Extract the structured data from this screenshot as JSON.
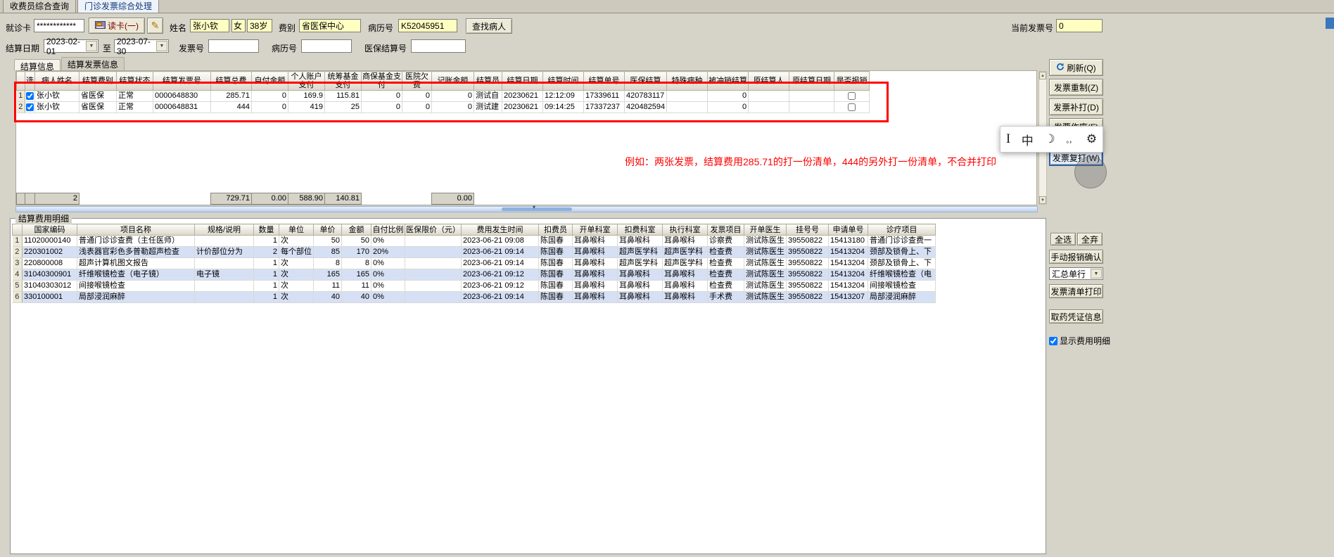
{
  "window_tabs": [
    {
      "label": "收费员综合查询",
      "active": false
    },
    {
      "label": "门诊发票综合处理",
      "active": true
    }
  ],
  "toolbar": {
    "visit_card_label": "就诊卡",
    "visit_card_value": "************",
    "read_card_button": "读卡(一)",
    "name_label": "姓名",
    "name_value": "张小钦",
    "gender_value": "女",
    "age_value": "38岁",
    "fee_type_label": "费别",
    "fee_type_value": "省医保中心",
    "mrn_label": "病历号",
    "mrn_value": "K52045951",
    "find_patient_button": "查找病人",
    "current_invoice_label": "当前发票号",
    "current_invoice_value": "0"
  },
  "filter": {
    "date_label": "结算日期",
    "date_from": "2023-02-01",
    "to_label": "至",
    "date_to": "2023-07-30",
    "invoice_no_label": "发票号",
    "invoice_no_value": "",
    "mrn_label": "病历号",
    "mrn_value": "",
    "insurance_no_label": "医保结算号",
    "insurance_no_value": ""
  },
  "page_tabs": [
    {
      "label": "结算信息",
      "active": true
    },
    {
      "label": "结算发票信息",
      "active": false
    }
  ],
  "settlement": {
    "columns": [
      "选",
      "病人姓名",
      "结算费别",
      "结算状态",
      "结算发票号",
      "结算总费",
      "自付金额",
      "个人账户支付",
      "统筹基金支付",
      "商保基金支付",
      "医院欠费",
      "记账金额",
      "结算员",
      "结算日期",
      "结算时间",
      "结算单号",
      "医保结算",
      "特殊病种",
      "被冲销结算",
      "原结算人",
      "原结算日期",
      "是否报销"
    ],
    "rows": [
      {
        "selected": true,
        "reimbursed": false,
        "cells": [
          "张小钦",
          "省医保",
          "正常",
          "0000648830",
          "285.71",
          "0",
          "169.9",
          "115.81",
          "0",
          "0",
          "0",
          "测试自",
          "20230621",
          "12:12:09",
          "17339611",
          "420783117",
          "",
          "0",
          "",
          ""
        ]
      },
      {
        "selected": true,
        "reimbursed": false,
        "cells": [
          "张小钦",
          "省医保",
          "正常",
          "0000648831",
          "444",
          "0",
          "419",
          "25",
          "0",
          "0",
          "0",
          "测试建",
          "20230621",
          "09:14:25",
          "17337237",
          "420482594",
          "",
          "0",
          "",
          ""
        ]
      }
    ],
    "summary": {
      "count": "2",
      "total_fee": "729.71",
      "self_pay": "0.00",
      "personal_account": "588.90",
      "pooled_fund": "140.81",
      "book_amount": "0.00"
    }
  },
  "annotation": "例如：两张发票，结算费用285.71的打一份清单，444的另外打一份清单，不合并打印",
  "detail": {
    "group_title": "结算费用明细",
    "columns": [
      "国家编码",
      "项目名称",
      "规格/说明",
      "数量",
      "单位",
      "单价",
      "金额",
      "自付比例",
      "医保限价（元）",
      "费用发生时间",
      "扣费员",
      "开单科室",
      "扣费科室",
      "执行科室",
      "发票项目",
      "开单医生",
      "挂号号",
      "申请单号",
      "诊疗项目"
    ],
    "rows": [
      [
        "11020000140",
        "普通门诊诊查费（主任医师）",
        "",
        "1",
        "次",
        "50",
        "50",
        "0%",
        "",
        "2023-06-21 09:08",
        "陈国春",
        "耳鼻喉科",
        "耳鼻喉科",
        "耳鼻喉科",
        "诊察费",
        "测试陈医生",
        "39550822",
        "15413180",
        "普通门诊诊查费一"
      ],
      [
        "220301002",
        "浅表器官彩色多普勒超声检查",
        "计价部位分为",
        "2",
        "每个部位",
        "85",
        "170",
        "20%",
        "",
        "2023-06-21 09:14",
        "陈国春",
        "耳鼻喉科",
        "超声医学科",
        "超声医学科",
        "检查费",
        "测试陈医生",
        "39550822",
        "15413204",
        "颈部及锁骨上、下"
      ],
      [
        "220800008",
        "超声计算机图文报告",
        "",
        "1",
        "次",
        "8",
        "8",
        "0%",
        "",
        "2023-06-21 09:14",
        "陈国春",
        "耳鼻喉科",
        "超声医学科",
        "超声医学科",
        "检查费",
        "测试陈医生",
        "39550822",
        "15413204",
        "颈部及锁骨上、下"
      ],
      [
        "31040300901",
        "纤维喉镜检查（电子镜）",
        "电子镜",
        "1",
        "次",
        "165",
        "165",
        "0%",
        "",
        "2023-06-21 09:12",
        "陈国春",
        "耳鼻喉科",
        "耳鼻喉科",
        "耳鼻喉科",
        "检查费",
        "测试陈医生",
        "39550822",
        "15413204",
        "纤维喉镜检查（电"
      ],
      [
        "31040303012",
        "间接喉镜检查",
        "",
        "1",
        "次",
        "11",
        "11",
        "0%",
        "",
        "2023-06-21 09:12",
        "陈国春",
        "耳鼻喉科",
        "耳鼻喉科",
        "耳鼻喉科",
        "检查费",
        "测试陈医生",
        "39550822",
        "15413204",
        "间接喉镜检查"
      ],
      [
        "330100001",
        "局部浸润麻醉",
        "",
        "1",
        "次",
        "40",
        "40",
        "0%",
        "",
        "2023-06-21 09:14",
        "陈国春",
        "耳鼻喉科",
        "耳鼻喉科",
        "耳鼻喉科",
        "手术费",
        "测试陈医生",
        "39550822",
        "15413207",
        "局部浸润麻醉"
      ]
    ]
  },
  "right_panel": {
    "buttons": [
      {
        "name": "refresh-button",
        "label": "刷新(Q)",
        "icon": "refresh"
      },
      {
        "name": "invoice-remake-button",
        "label": "发票重制(Z)"
      },
      {
        "name": "invoice-supplement-print-button",
        "label": "发票补打(D)"
      },
      {
        "name": "invoice-void-button",
        "label": "发票作废(F)"
      },
      {
        "name": "invoice-copy-print-button",
        "label": "发票复打(W)",
        "focused": true
      }
    ],
    "select_all_button": "全选",
    "deselect_all_button": "全弃",
    "manual_reimburse_button": "手动报销确认",
    "summary_mode_value": "汇总单行",
    "invoice_list_print_button": "发票清单打印",
    "pharmacy_voucher_button": "取药凭证信息",
    "show_detail_checkbox": {
      "label": "显示费用明细",
      "checked": true
    }
  },
  "ime": {
    "cursor_glyph": "I",
    "mode_glyph": "中",
    "width_glyph": "☽",
    "punctuation_glyph": "。，",
    "settings_glyph": "⚙"
  }
}
